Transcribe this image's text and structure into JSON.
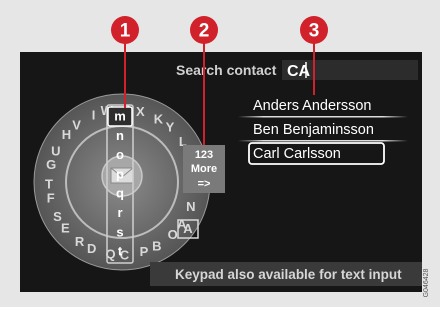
{
  "screen": {
    "search_label": "Search contact",
    "search_value": "CA",
    "side_option_line1": "123",
    "side_option_line2": "More",
    "side_option_line3": "=>",
    "mode_box": "A",
    "footer_hint": "Keypad also available for text input",
    "image_code": "G046428"
  },
  "wheel_letters": [
    "A",
    "B",
    "C",
    "D",
    "E",
    "F",
    "G",
    "H",
    "I",
    "J",
    "K",
    "L",
    "M",
    "N",
    "O",
    "P",
    "Q",
    "R",
    "S",
    "T",
    "U",
    "V",
    "W",
    "X",
    "Y",
    "Z"
  ],
  "column_letters": [
    "m",
    "n",
    "o",
    "p",
    "q",
    "r",
    "s",
    "t"
  ],
  "contacts": [
    {
      "name": "Anders Andersson",
      "selected": false
    },
    {
      "name": "Ben  Benjaminsson",
      "selected": false
    },
    {
      "name": "Carl Carlsson",
      "selected": true
    }
  ],
  "callouts": [
    "1",
    "2",
    "3"
  ],
  "colors": {
    "callout_red": "#d1212a",
    "screen_bg": "#161616",
    "frame": "#e6e6e6"
  }
}
